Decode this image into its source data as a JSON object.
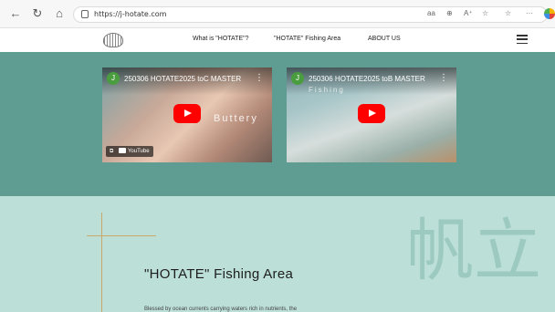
{
  "browser": {
    "back_glyph": "←",
    "refresh_glyph": "↻",
    "home_glyph": "⌂",
    "url": "https://j-hotate.com",
    "right_icons": [
      "aa",
      "⊕",
      "A⁺",
      "☆",
      "☆",
      "···"
    ]
  },
  "header": {
    "nav": [
      "What is \"HOTATE\"?",
      "\"HOTATE\" Fishing Area",
      "ABOUT US"
    ]
  },
  "videos": [
    {
      "avatar_letter": "J",
      "title": "250306 HOTATE2025 toC MASTER",
      "overlay": "Buttery",
      "watch_label": "YouTube"
    },
    {
      "avatar_letter": "J",
      "title": "250306 HOTATE2025 toB MASTER",
      "overlay": "Fishing"
    }
  ],
  "fishing": {
    "kanji": "帆立",
    "title": "\"HOTATE\" Fishing Area",
    "body": "Blessed by ocean currents carrying waters rich in nutrients, the"
  },
  "colors": {
    "band": "#5f9c92",
    "section": "#bcdfd8",
    "accent_line": "#c9a86a",
    "play": "#ff0000"
  }
}
